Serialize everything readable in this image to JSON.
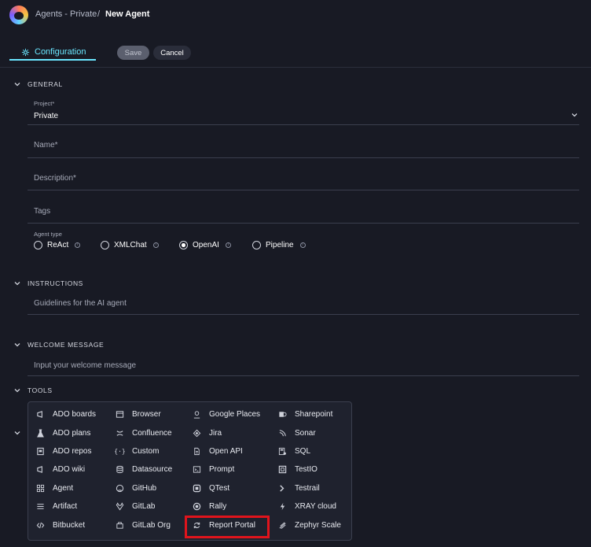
{
  "header": {
    "breadcrumb_parent": "Agents - Private",
    "separator": "/",
    "breadcrumb_current": "New Agent"
  },
  "tabs": {
    "configuration": "Configuration"
  },
  "toolbar": {
    "save_label": "Save",
    "cancel_label": "Cancel"
  },
  "general": {
    "title": "GENERAL",
    "project_label": "Project*",
    "project_value": "Private",
    "name_placeholder": "Name*",
    "description_placeholder": "Description*",
    "tags_placeholder": "Tags",
    "agent_type_label": "Agent type",
    "agent_types": [
      "ReAct",
      "XMLChat",
      "OpenAI",
      "Pipeline"
    ],
    "selected_agent_type": "OpenAI"
  },
  "instructions": {
    "title": "INSTRUCTIONS",
    "placeholder": "Guidelines for the AI agent"
  },
  "welcome": {
    "title": "WELCOME MESSAGE",
    "placeholder": "Input your welcome message"
  },
  "tools": {
    "title": "TOOLS",
    "columns": [
      [
        "ADO boards",
        "ADO plans",
        "ADO repos",
        "ADO wiki",
        "Agent",
        "Artifact",
        "Bitbucket"
      ],
      [
        "Browser",
        "Confluence",
        "Custom",
        "Datasource",
        "GitHub",
        "GitLab",
        "GitLab Org"
      ],
      [
        "Google Places",
        "Jira",
        "Open API",
        "Prompt",
        "QTest",
        "Rally",
        "Report Portal"
      ],
      [
        "Sharepoint",
        "Sonar",
        "SQL",
        "TestIO",
        "Testrail",
        "XRAY cloud",
        "Zephyr Scale"
      ]
    ],
    "highlighted": "Report Portal"
  },
  "colors": {
    "accent": "#6ae6ff",
    "background": "#181a24",
    "highlight": "#e0141c"
  }
}
